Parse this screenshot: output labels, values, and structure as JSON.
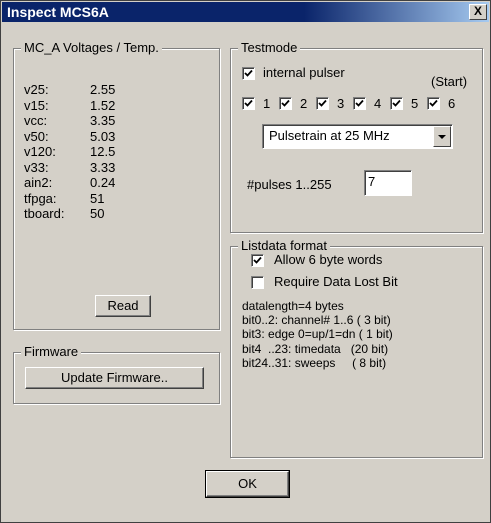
{
  "window": {
    "title": "Inspect MCS6A",
    "close_glyph": "X"
  },
  "voltages": {
    "title": "MC_A Voltages / Temp.",
    "rows": [
      {
        "label": "v25:",
        "value": "2.55"
      },
      {
        "label": "v15:",
        "value": "1.52"
      },
      {
        "label": "vcc:",
        "value": "3.35"
      },
      {
        "label": "v50:",
        "value": "5.03"
      },
      {
        "label": "v120:",
        "value": "12.5"
      },
      {
        "label": "v33:",
        "value": "3.33"
      },
      {
        "label": "ain2:",
        "value": "0.24"
      },
      {
        "label": "tfpga:",
        "value": "51"
      },
      {
        "label": "tboard:",
        "value": "50"
      }
    ],
    "read_button": "Read"
  },
  "firmware": {
    "title": "Firmware",
    "update_button": "Update Firmware.."
  },
  "testmode": {
    "title": "Testmode",
    "internal_pulser": {
      "label": "internal pulser",
      "checked": true
    },
    "start_label": "(Start)",
    "channels": [
      {
        "label": "1",
        "checked": true
      },
      {
        "label": "2",
        "checked": true
      },
      {
        "label": "3",
        "checked": true
      },
      {
        "label": "4",
        "checked": true
      },
      {
        "label": "5",
        "checked": true
      },
      {
        "label": "6",
        "checked": true
      }
    ],
    "pulse_select": "Pulsetrain at 25 MHz",
    "pulses_label": "#pulses 1..255",
    "pulses_value": "7"
  },
  "listdata": {
    "title": "Listdata format",
    "allow6": {
      "label": "Allow 6 byte words",
      "checked": true
    },
    "require": {
      "label": "Require Data Lost Bit",
      "checked": false
    },
    "info_lines": [
      "datalength=4 bytes",
      "bit0..2: channel# 1..6 ( 3 bit)",
      "bit3: edge 0=up/1=dn ( 1 bit)",
      "bit4  ..23: timedata   (20 bit)",
      "bit24..31: sweeps     ( 8 bit)"
    ]
  },
  "ok_button": "OK"
}
